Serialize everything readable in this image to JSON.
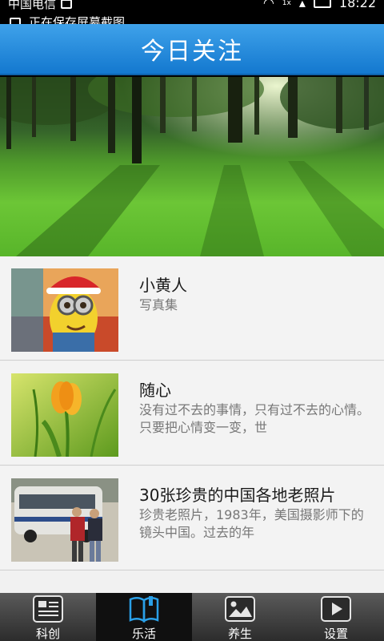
{
  "status_bar": {
    "carrier": "中国电信",
    "notification": "正在保存屏幕截图",
    "time": "18:22",
    "network": "1x"
  },
  "header": {
    "title": "今日关注"
  },
  "banner": {
    "icon": "forest-photo"
  },
  "items": [
    {
      "title": "小黄人",
      "desc": "写真集",
      "icon": "minion-photo"
    },
    {
      "title": "随心",
      "desc": "没有过不去的事情，只有过不去的心情。只要把心情变一变，世",
      "icon": "tulip-photo"
    },
    {
      "title": "30张珍贵的中国各地老照片",
      "desc": "珍贵老照片，1983年，美国摄影师下的镜头中国。过去的年",
      "icon": "old-photo"
    }
  ],
  "nav": [
    {
      "label": "科创",
      "icon": "newspaper-icon",
      "active": false
    },
    {
      "label": "乐活",
      "icon": "book-icon",
      "active": true
    },
    {
      "label": "养生",
      "icon": "picture-icon",
      "active": false
    },
    {
      "label": "设置",
      "icon": "play-icon",
      "active": false
    }
  ],
  "colors": {
    "header": "#1a82d8",
    "active_nav": "#2aa0e8",
    "nav_bg": "#3a3a3a"
  }
}
